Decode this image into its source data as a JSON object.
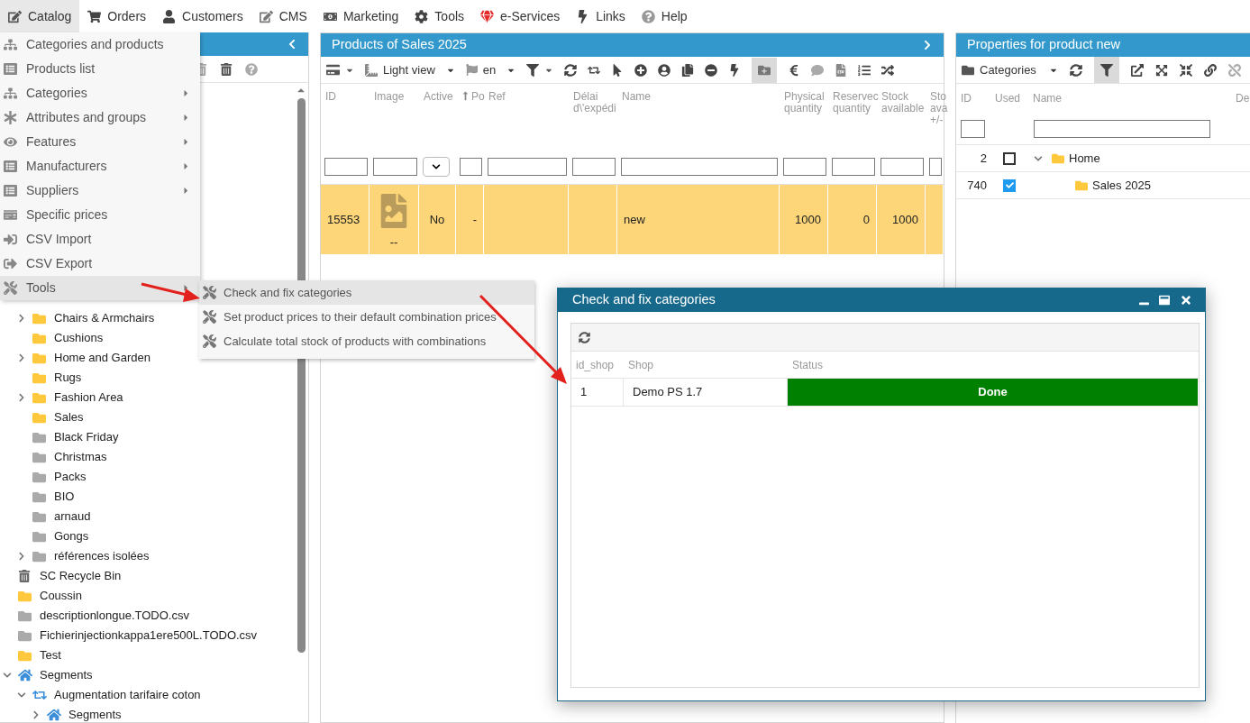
{
  "menu_bar": [
    {
      "label": "Catalog",
      "selected": true
    },
    {
      "label": "Orders",
      "selected": false
    },
    {
      "label": "Customers",
      "selected": false
    },
    {
      "label": "CMS",
      "selected": false
    },
    {
      "label": "Marketing",
      "selected": false
    },
    {
      "label": "Tools",
      "selected": false
    },
    {
      "label": "e-Services",
      "selected": false
    },
    {
      "label": "Links",
      "selected": false
    },
    {
      "label": "Help",
      "selected": false
    }
  ],
  "catalog_menu": [
    {
      "label": "Categories and products",
      "has_submenu": false,
      "selected": false
    },
    {
      "label": "Products list",
      "has_submenu": false,
      "selected": false
    },
    {
      "label": "Categories",
      "has_submenu": true,
      "selected": false
    },
    {
      "label": "Attributes and groups",
      "has_submenu": true,
      "selected": false
    },
    {
      "label": "Features",
      "has_submenu": true,
      "selected": false
    },
    {
      "label": "Manufacturers",
      "has_submenu": true,
      "selected": false
    },
    {
      "label": "Suppliers",
      "has_submenu": true,
      "selected": false
    },
    {
      "label": "Specific prices",
      "has_submenu": false,
      "selected": false
    },
    {
      "label": "CSV Import",
      "has_submenu": false,
      "selected": false
    },
    {
      "label": "CSV Export",
      "has_submenu": false,
      "selected": false
    },
    {
      "label": "Tools",
      "has_submenu": true,
      "selected": true
    }
  ],
  "tools_submenu": [
    {
      "label": "Check and fix categories",
      "selected": true
    },
    {
      "label": "Set product prices to their default combination prices",
      "selected": false
    },
    {
      "label": "Calculate total stock of products with combinations",
      "selected": false
    }
  ],
  "left_panel": {
    "subcategories": [
      {
        "label": "Chairs & Armchairs",
        "kind": "folder",
        "color": "#ffc83d",
        "expanded": false
      },
      {
        "label": "Cushions",
        "kind": "folder",
        "color": "#ffc83d"
      },
      {
        "label": "Home and Garden",
        "kind": "folder",
        "color": "#ffc83d",
        "expanded": false
      },
      {
        "label": "Rugs",
        "kind": "folder",
        "color": "#ffc83d"
      },
      {
        "label": "Fashion Area",
        "kind": "folder",
        "color": "#ffc83d",
        "expanded": false
      },
      {
        "label": "Sales",
        "kind": "folder",
        "color": "#ffc83d"
      },
      {
        "label": "Black Friday",
        "kind": "folder",
        "color": "#aaaaaa"
      },
      {
        "label": "Christmas",
        "kind": "folder",
        "color": "#aaaaaa"
      },
      {
        "label": "Packs",
        "kind": "folder",
        "color": "#aaaaaa"
      },
      {
        "label": "BIO",
        "kind": "folder",
        "color": "#aaaaaa"
      },
      {
        "label": "arnaud",
        "kind": "folder",
        "color": "#aaaaaa"
      },
      {
        "label": "Gongs",
        "kind": "folder",
        "color": "#aaaaaa"
      },
      {
        "label": "références isolées",
        "kind": "folder",
        "color": "#aaaaaa",
        "expanded": false
      }
    ],
    "tree": [
      {
        "label": "SC Recycle Bin",
        "kind": "trash"
      },
      {
        "label": "Coussin",
        "kind": "folder",
        "color": "#ffc83d"
      },
      {
        "label": "descriptionlongue.TODO.csv",
        "kind": "folder",
        "color": "#aaaaaa"
      },
      {
        "label": "Fichierinjectionkappa1ere500L.TODO.csv",
        "kind": "folder",
        "color": "#aaaaaa"
      },
      {
        "label": "Test",
        "kind": "folder",
        "color": "#ffc83d"
      },
      {
        "label": "Segments",
        "kind": "home",
        "expanded": true,
        "children": [
          {
            "label": "Augmentation tarifaire coton",
            "kind": "segment",
            "expanded": true,
            "children": [
              {
                "label": "Segments",
                "kind": "home",
                "expanded": false
              }
            ]
          }
        ]
      }
    ]
  },
  "products_panel": {
    "title": "Products of Sales 2025",
    "view": "Light view",
    "language": "en",
    "category_button_pressed": true,
    "columns": [
      {
        "label": "ID",
        "kind": "text"
      },
      {
        "label": "Image",
        "kind": "text"
      },
      {
        "label": "Active",
        "kind": "select"
      },
      {
        "label": "Po",
        "kind": "text",
        "sorted": true
      },
      {
        "label": "Ref",
        "kind": "text"
      },
      {
        "label": "Délai d\\'expédi",
        "kind": "text"
      },
      {
        "label": "Name",
        "kind": "text"
      },
      {
        "label": "Physical quantity",
        "kind": "text"
      },
      {
        "label": "Reservec quantity",
        "kind": "text"
      },
      {
        "label": "Stock available",
        "kind": "text"
      },
      {
        "label": "Sto ava +/-",
        "kind": "text"
      }
    ],
    "rows": [
      {
        "selected": true,
        "cells": [
          "15553",
          "--",
          "No",
          "-",
          null,
          null,
          "new",
          "1000",
          "0",
          "1000",
          null
        ]
      }
    ]
  },
  "properties_panel": {
    "title": "Properties for product new",
    "view": "Categories",
    "filter_pressed": true,
    "columns": [
      "ID",
      "Used",
      "Name",
      "De"
    ],
    "rows": [
      {
        "id": "2",
        "used": false,
        "label": "Home",
        "expanded": true,
        "children": [
          {
            "id": "740",
            "used": true,
            "label": "Sales 2025"
          }
        ]
      }
    ]
  },
  "dialog": {
    "title": "Check and fix categories",
    "columns": [
      {
        "label": "id_shop",
        "kind": "text"
      },
      {
        "label": "Shop",
        "kind": "text"
      },
      {
        "label": "Status",
        "kind": "status"
      }
    ],
    "rows": [
      {
        "cells": [
          "1",
          "Demo PS 1.7",
          "Done"
        ]
      }
    ]
  }
}
